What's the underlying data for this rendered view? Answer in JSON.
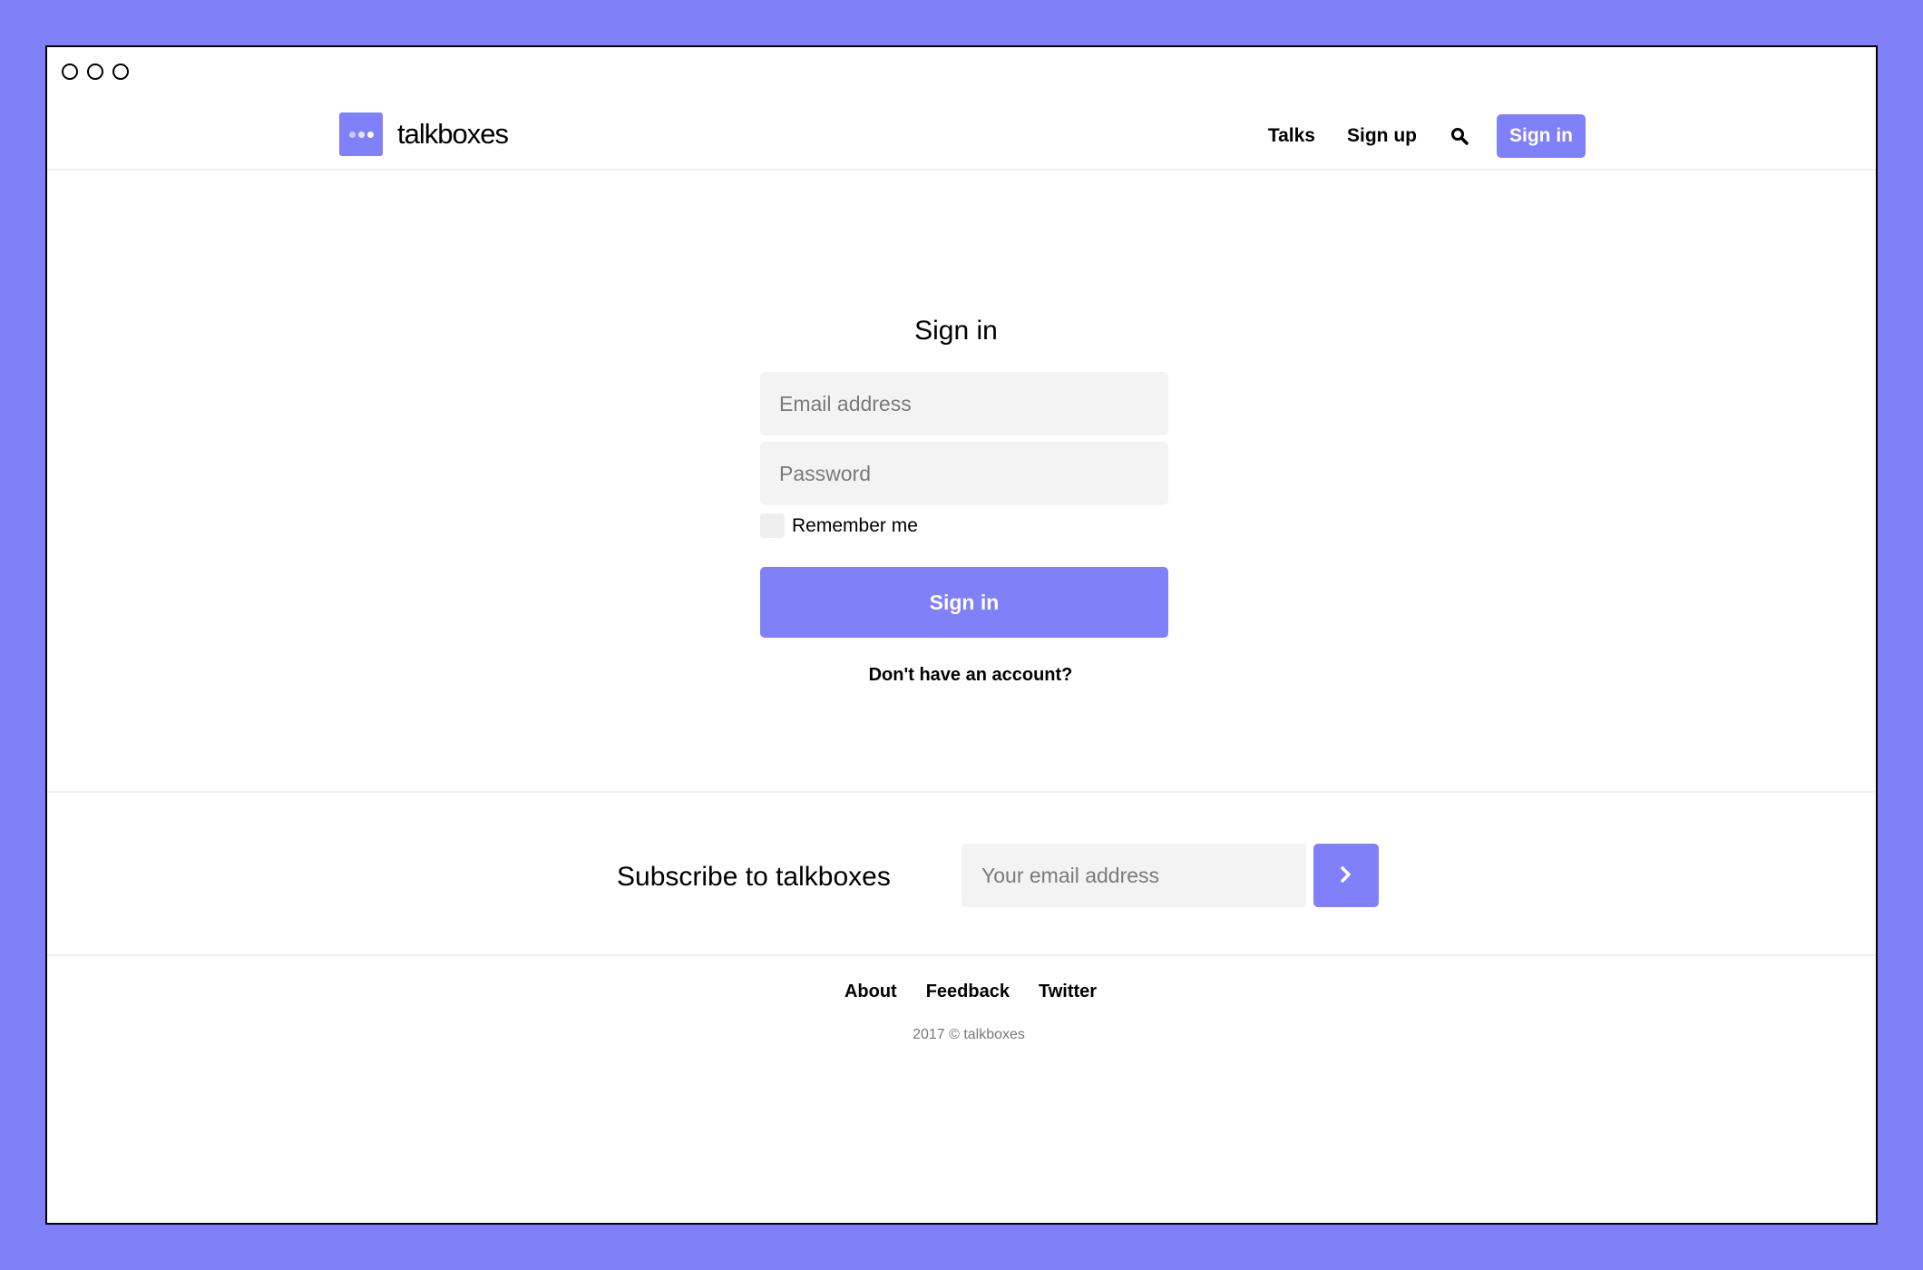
{
  "colors": {
    "accent": "#8080f9",
    "field_bg": "#f3f3f3"
  },
  "header": {
    "logo_text": "talkboxes",
    "nav": {
      "talks": "Talks",
      "sign_up": "Sign up",
      "sign_in": "Sign in"
    },
    "search_icon": "search-icon"
  },
  "signin": {
    "title": "Sign in",
    "email_placeholder": "Email address",
    "password_placeholder": "Password",
    "remember_label": "Remember me",
    "submit_label": "Sign in",
    "no_account": "Don't have an account?"
  },
  "subscribe": {
    "title": "Subscribe to talkboxes",
    "email_placeholder": "Your email address",
    "submit_icon": "chevron-right-icon"
  },
  "footer": {
    "links": [
      "About",
      "Feedback",
      "Twitter"
    ],
    "copyright": "2017 © talkboxes"
  }
}
